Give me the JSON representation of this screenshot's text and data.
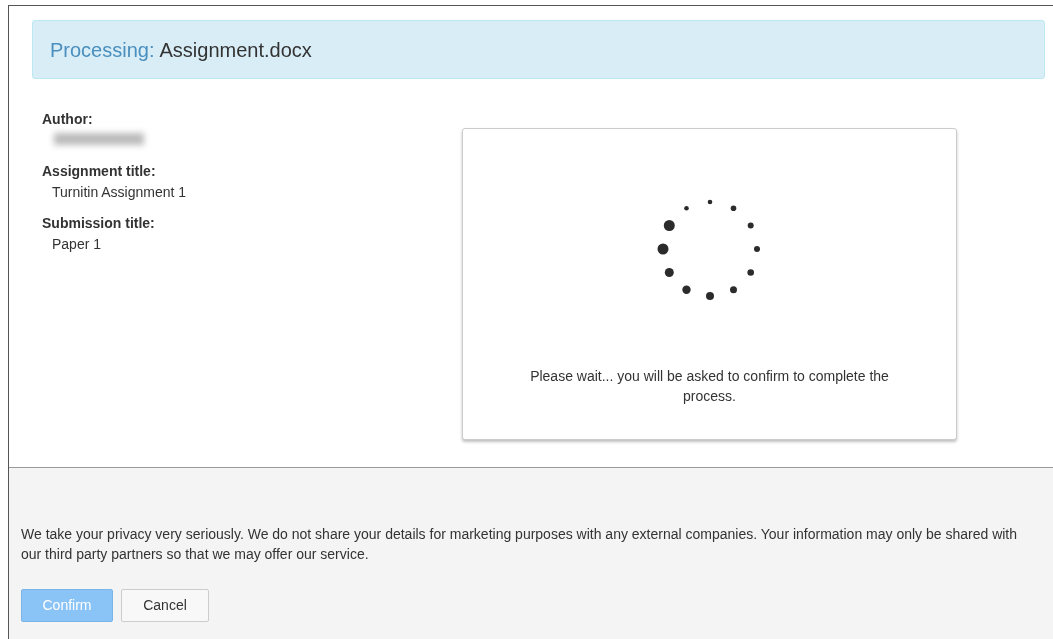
{
  "header": {
    "label": "Processing:",
    "filename": "Assignment.docx"
  },
  "details": [
    {
      "label": "Author:",
      "redacted": true
    },
    {
      "label": "Assignment title:",
      "value": "Turnitin Assignment 1"
    },
    {
      "label": "Submission title:",
      "value": "Paper 1"
    }
  ],
  "status_card": {
    "message": "Please wait... you will be asked to confirm to complete the process."
  },
  "privacy_notice": "We take your privacy very seriously. We do not share your details for marketing purposes with any external companies. Your information may only be shared with our third party partners so that we may offer our service.",
  "buttons": [
    {
      "label": "Confirm",
      "kind": "primary",
      "disabled": true
    },
    {
      "label": "Cancel",
      "kind": "secondary",
      "disabled": false
    }
  ]
}
